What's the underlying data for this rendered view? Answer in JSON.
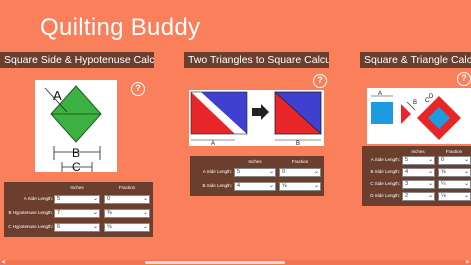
{
  "app": {
    "title": "Quilting Buddy"
  },
  "panels": [
    {
      "title": "Square Side & Hypotenuse Calculator",
      "help": "?",
      "illustration_labels": [
        "A",
        "B",
        "C"
      ],
      "columns": [
        "Inches",
        "Fraction"
      ],
      "rows": [
        {
          "label": "A Side Length:",
          "inches": "5",
          "fraction": "0"
        },
        {
          "label": "B Hypotenuse Length:",
          "inches": "7",
          "fraction": "⅜"
        },
        {
          "label": "C Hypotenuse Length:",
          "inches": "6",
          "fraction": "⅝"
        }
      ]
    },
    {
      "title": "Two Triangles to Square Calculator",
      "help": "?",
      "illustration_labels": [
        "A",
        "B"
      ],
      "columns": [
        "Inches",
        "Fraction"
      ],
      "rows": [
        {
          "label": "A Side Length:",
          "inches": "5",
          "fraction": "0"
        },
        {
          "label": "B Side Length:",
          "inches": "4",
          "fraction": "⅝"
        }
      ]
    },
    {
      "title": "Square & Triangle Calculat",
      "help": "?",
      "illustration_labels": [
        "A",
        "B",
        "C",
        "D"
      ],
      "columns": [
        "Inches",
        "Fraction"
      ],
      "rows": [
        {
          "label": "A Side Length:",
          "inches": "5",
          "fraction": "0"
        },
        {
          "label": "B Side Length:",
          "inches": "4",
          "fraction": "⅝"
        },
        {
          "label": "C Side Length:",
          "inches": "3",
          "fraction": "¼"
        },
        {
          "label": "D Side Length:",
          "inches": "2",
          "fraction": "⅛"
        }
      ]
    }
  ],
  "colors": {
    "background": "#f9805a",
    "header": "#6b3e2e",
    "green": "#3cb043",
    "red": "#e8262a",
    "blue": "#3f3fd0",
    "cyan": "#1e9be0"
  }
}
